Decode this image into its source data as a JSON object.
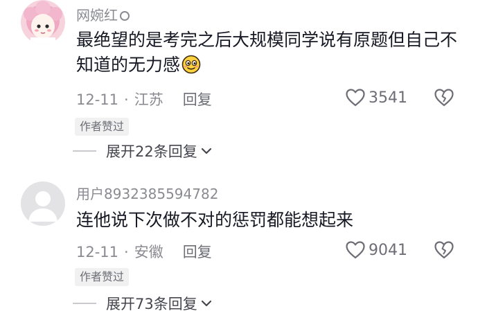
{
  "comments": [
    {
      "username": "网婉红",
      "text": "最绝望的是考完之后大规模同学说有原题但自己不知道的无力感",
      "emoji": "smiling-face-emoji",
      "date": "12-11",
      "location": "江苏",
      "reply_label": "回复",
      "likes": "3541",
      "tag": "作者赞过",
      "expand_label": "展开22条回复"
    },
    {
      "username": "用户8932385594782",
      "text": "连他说下次做不对的惩罚都能想起来",
      "date": "12-11",
      "location": "安徽",
      "reply_label": "回复",
      "likes": "9041",
      "tag": "作者赞过",
      "expand_label": "展开73条回复"
    }
  ],
  "separator": "·",
  "icons": {
    "like": "heart-outline-icon",
    "dislike": "broken-heart-icon",
    "expand": "chevron-down-icon",
    "badge": "circle-badge-icon"
  },
  "colors": {
    "text_primary": "#161823",
    "text_secondary": "#8a8b91",
    "tag_bg": "#f1f1f2"
  }
}
